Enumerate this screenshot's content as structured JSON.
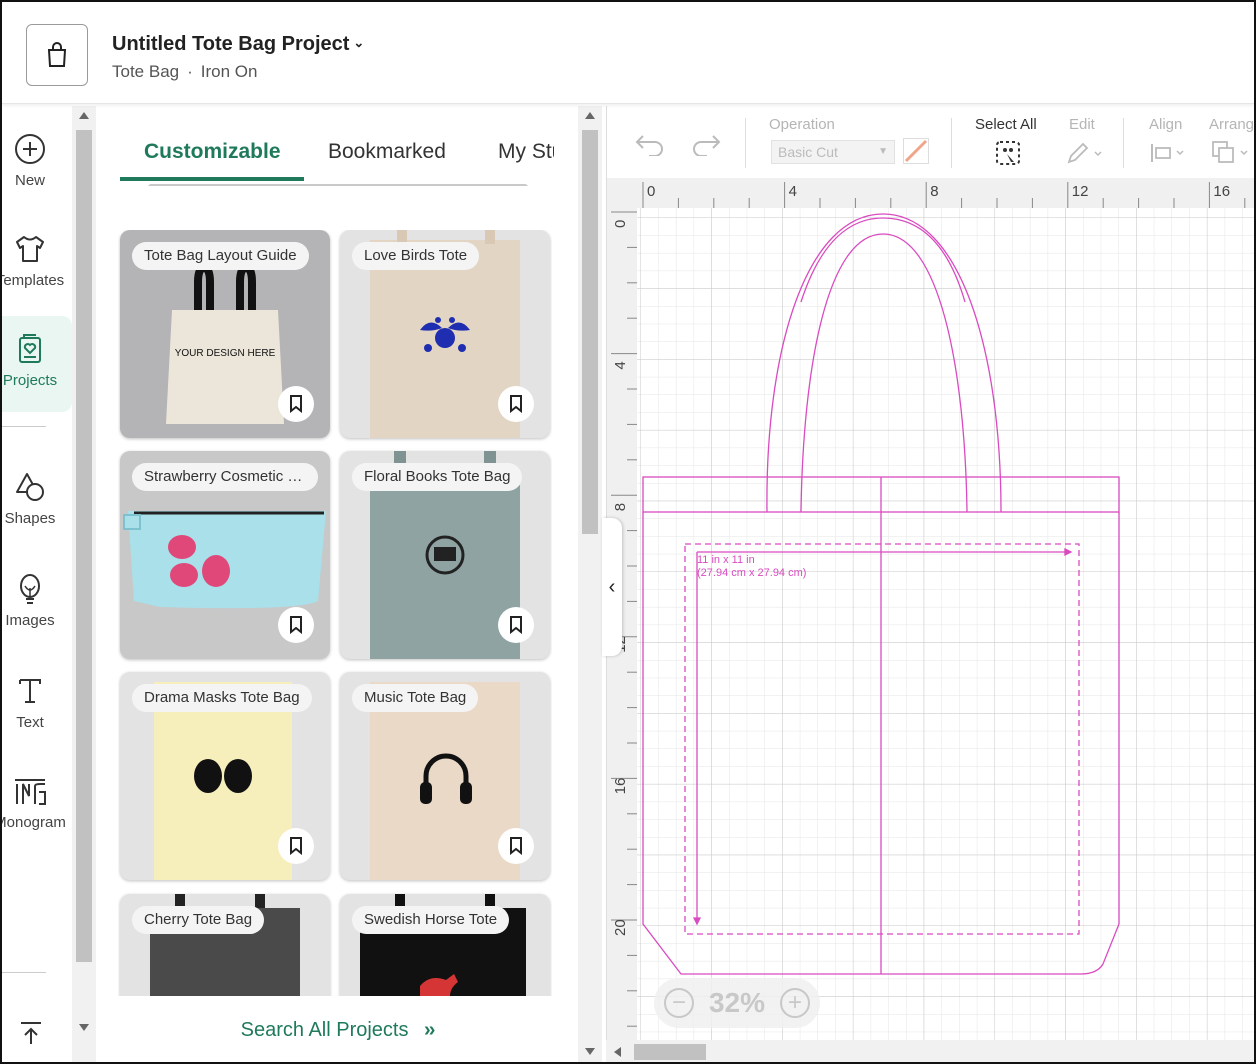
{
  "header": {
    "title": "Untitled Tote Bag Project",
    "subtitle_type": "Tote Bag",
    "subtitle_separator": "·",
    "subtitle_material": "Iron On"
  },
  "nav": {
    "items": [
      {
        "label": "New",
        "icon": "plus-circle-icon"
      },
      {
        "label": "Templates",
        "icon": "tshirt-icon"
      },
      {
        "label": "Projects",
        "icon": "projects-icon"
      },
      {
        "label": "Shapes",
        "icon": "shapes-icon"
      },
      {
        "label": "Images",
        "icon": "lightbulb-icon"
      },
      {
        "label": "Text",
        "icon": "text-icon"
      },
      {
        "label": "Monogram",
        "icon": "monogram-icon"
      }
    ]
  },
  "panel": {
    "tabs": [
      "Customizable",
      "Bookmarked",
      "My Stuff"
    ],
    "active_tab": "Customizable",
    "cards": [
      {
        "title": "Tote Bag Layout Guide",
        "print": "YOUR DESIGN HERE"
      },
      {
        "title": "Love Birds Tote"
      },
      {
        "title": "Strawberry Cosmetic Bag"
      },
      {
        "title": "Floral Books Tote Bag"
      },
      {
        "title": "Drama Masks Tote Bag"
      },
      {
        "title": "Music Tote Bag"
      },
      {
        "title": "Cherry Tote Bag"
      },
      {
        "title": "Swedish Horse Tote"
      }
    ],
    "search_all": "Search All Projects"
  },
  "toolbar": {
    "operation_label": "Operation",
    "operation_value": "Basic Cut",
    "select_all": "Select All",
    "edit": "Edit",
    "align": "Align",
    "arrange": "Arrange"
  },
  "canvas": {
    "ruler_x": [
      "0",
      "4",
      "8",
      "12",
      "16"
    ],
    "ruler_y": [
      "0",
      "4",
      "8",
      "12",
      "16",
      "20"
    ],
    "dimension_line1": "11 in x 11 in",
    "dimension_line2": "(27.94 cm x 27.94 cm)",
    "guide_color": "#d94bc0"
  },
  "zoom": {
    "value": "32%"
  },
  "colors": {
    "accent": "#1f7a5c",
    "guide": "#d94bc0"
  }
}
